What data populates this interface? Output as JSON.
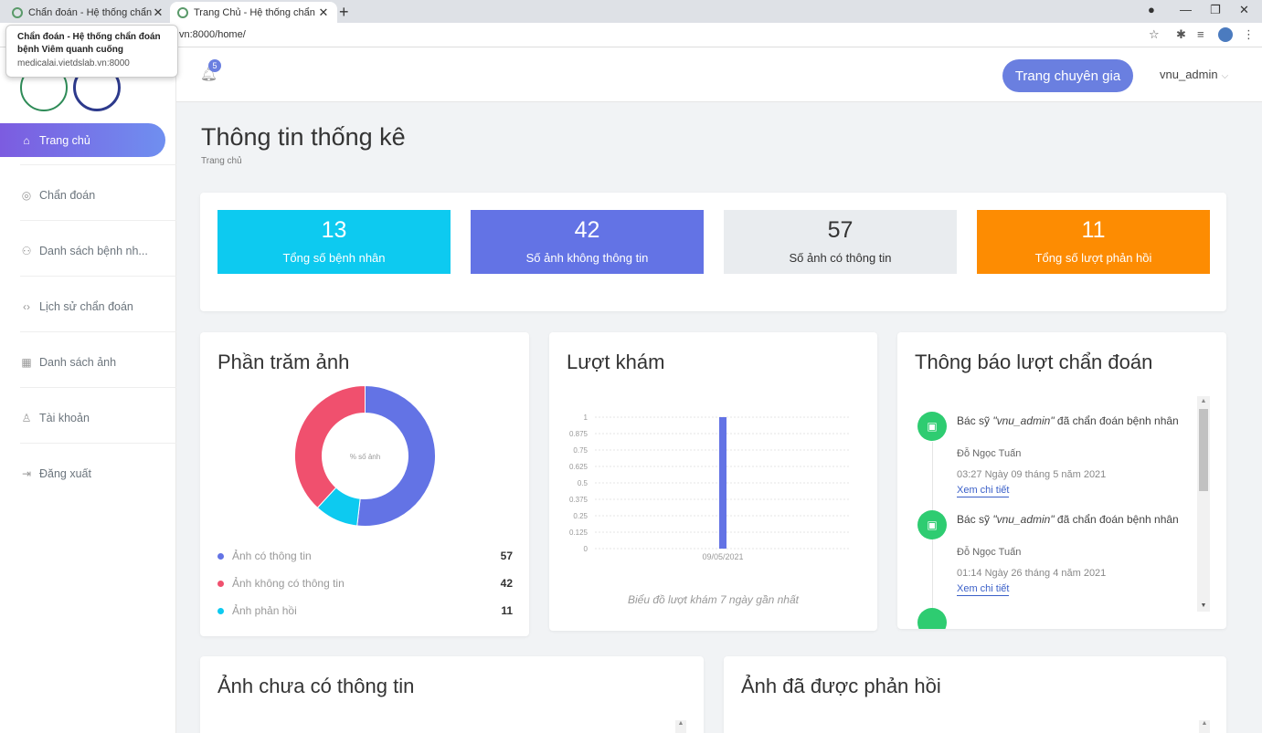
{
  "browser": {
    "tabs": [
      {
        "title": "Chẩn đoán - Hệ thống chẩn đoán"
      },
      {
        "title": "Trang Chủ - Hệ thống chẩn đoán"
      }
    ],
    "url": "vn:8000/home/",
    "tooltip": {
      "title": "Chẩn đoán - Hệ thống chẩn đoán bệnh Viêm quanh cuống",
      "url": "medicalai.vietdslab.vn:8000"
    }
  },
  "sidebar": {
    "items": [
      {
        "label": "Trang chủ",
        "icon": "home-icon"
      },
      {
        "label": "Chẩn đoán",
        "icon": "target-icon"
      },
      {
        "label": "Danh sách bệnh nh...",
        "icon": "users-icon"
      },
      {
        "label": "Lịch sử chẩn đoán",
        "icon": "code-icon"
      },
      {
        "label": "Danh sách ảnh",
        "icon": "grid-icon"
      },
      {
        "label": "Tài khoản",
        "icon": "user-icon"
      },
      {
        "label": "Đăng xuất",
        "icon": "logout-icon"
      }
    ]
  },
  "header": {
    "notification_count": "5",
    "expert_button": "Trang chuyên gia",
    "username": "vnu_admin"
  },
  "main": {
    "title": "Thông tin thống kê",
    "breadcrumb": "Trang chủ",
    "stats": [
      {
        "value": "13",
        "label": "Tổng số bệnh nhân",
        "color": "#0dcaf0"
      },
      {
        "value": "42",
        "label": "Số ảnh không thông tin",
        "color": "#6373e5"
      },
      {
        "value": "57",
        "label": "Số ảnh có thông tin",
        "color": "#e9ecef"
      },
      {
        "value": "11",
        "label": "Tổng số lượt phản hồi",
        "color": "#fd8c02"
      }
    ]
  },
  "donut": {
    "title": "Phần trăm ảnh",
    "center_label": "% số ảnh"
  },
  "visits": {
    "title": "Lượt khám",
    "caption": "Biểu đồ lượt khám 7 ngày gần nhất"
  },
  "notifications": {
    "title": "Thông báo lượt chẩn đoán",
    "items": [
      {
        "prefix": "Bác sỹ ",
        "doctor": "\"vnu_admin\"",
        "suffix": " đã chẩn đoán bệnh nhân",
        "patient": "Đỗ Ngọc Tuấn",
        "time": "03:27 Ngày 09 tháng 5 năm 2021",
        "link": "Xem chi tiết"
      },
      {
        "prefix": "Bác sỹ ",
        "doctor": "\"vnu_admin\"",
        "suffix": " đã chẩn đoán bệnh nhân",
        "patient": "Đỗ Ngọc Tuấn",
        "time": "01:14 Ngày 26 tháng 4 năm 2021",
        "link": "Xem chi tiết"
      }
    ]
  },
  "bottom": {
    "left_title": "Ảnh chưa có thông tin",
    "right_title": "Ảnh đã được phản hồi"
  },
  "chart_data": [
    {
      "type": "pie",
      "categories": [
        "Ảnh có thông tin",
        "Ảnh không có thông tin",
        "Ảnh phản hồi"
      ],
      "values": [
        57,
        42,
        11
      ],
      "colors": [
        "#6373e5",
        "#f0506e",
        "#0dcaf0"
      ],
      "title": "Phần trăm ảnh"
    },
    {
      "type": "bar",
      "categories": [
        "09/05/2021"
      ],
      "values": [
        1
      ],
      "colors": [
        "#6373e5"
      ],
      "ylim": [
        0,
        1
      ],
      "yticks": [
        "1",
        "0.875",
        "0.75",
        "0.625",
        "0.5",
        "0.375",
        "0.25",
        "0.125",
        "0"
      ],
      "grid": true,
      "title": "Lượt khám"
    }
  ]
}
